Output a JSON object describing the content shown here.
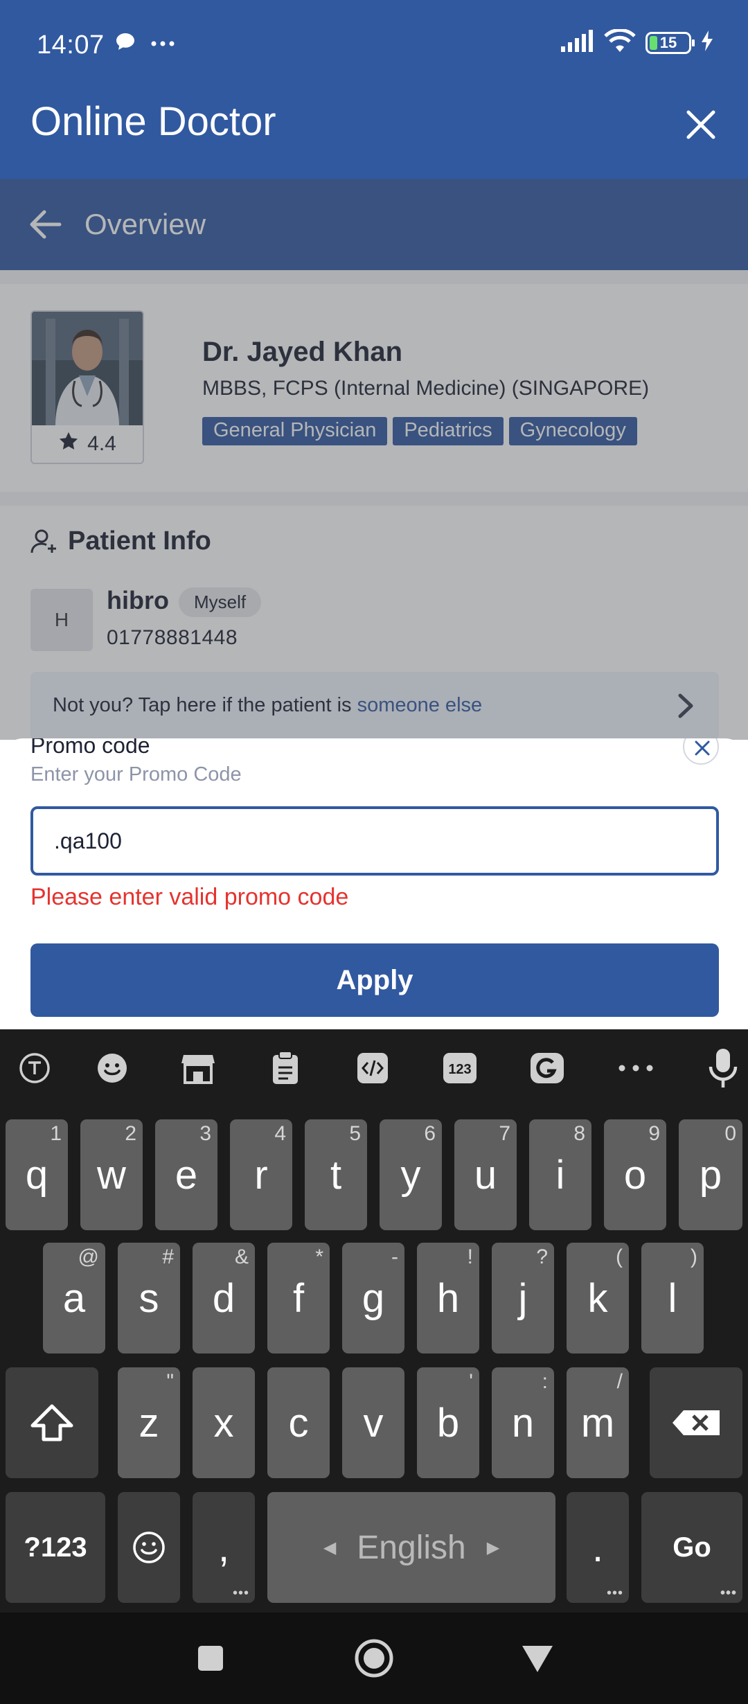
{
  "status_bar": {
    "time": "14:07",
    "battery_level": "15",
    "icons": [
      "chat-bubble-icon",
      "more-dots-icon",
      "signal-icon",
      "wifi-icon",
      "battery-icon",
      "charging-icon"
    ]
  },
  "app_bar": {
    "title": "Online Doctor",
    "close_icon": "close-icon"
  },
  "subheader": {
    "title": "Overview",
    "back_icon": "arrow-left-icon"
  },
  "doctor": {
    "name": "Dr. Jayed Khan",
    "degree": "MBBS, FCPS (Internal Medicine) (SINGAPORE)",
    "rating": "4.4",
    "tags": [
      "General Physician",
      "Pediatrics",
      "Gynecology"
    ]
  },
  "patient": {
    "heading": "Patient Info",
    "avatar_initial": "H",
    "name": "hibro",
    "relation": "Myself",
    "phone": "01778881448",
    "not_you_text": "Not you? Tap here if the patient is ",
    "not_you_link": "someone else"
  },
  "promo_sheet": {
    "label": "Promo code",
    "hint": "Enter your Promo Code",
    "input_value": ".qa100",
    "error": "Please enter valid promo code",
    "apply_label": "Apply"
  },
  "keyboard": {
    "toolbar_icons": [
      "text-cursor-icon",
      "emoji-icon",
      "store-icon",
      "clipboard-icon",
      "code-icon",
      "numbers-icon",
      "g-icon",
      "more-icon",
      "microphone-icon"
    ],
    "toolbar_123": "123",
    "row1": [
      {
        "key": "q",
        "hint": "1"
      },
      {
        "key": "w",
        "hint": "2"
      },
      {
        "key": "e",
        "hint": "3"
      },
      {
        "key": "r",
        "hint": "4"
      },
      {
        "key": "t",
        "hint": "5"
      },
      {
        "key": "y",
        "hint": "6"
      },
      {
        "key": "u",
        "hint": "7"
      },
      {
        "key": "i",
        "hint": "8"
      },
      {
        "key": "o",
        "hint": "9"
      },
      {
        "key": "p",
        "hint": "0"
      }
    ],
    "row2": [
      {
        "key": "a",
        "hint": "@"
      },
      {
        "key": "s",
        "hint": "#"
      },
      {
        "key": "d",
        "hint": "&"
      },
      {
        "key": "f",
        "hint": "*"
      },
      {
        "key": "g",
        "hint": "-"
      },
      {
        "key": "h",
        "hint": "!"
      },
      {
        "key": "j",
        "hint": "?"
      },
      {
        "key": "k",
        "hint": "("
      },
      {
        "key": "l",
        "hint": ")"
      }
    ],
    "row3": [
      {
        "key": "z",
        "hint": "\""
      },
      {
        "key": "x",
        "hint": ""
      },
      {
        "key": "c",
        "hint": ""
      },
      {
        "key": "v",
        "hint": ""
      },
      {
        "key": "b",
        "hint": "'"
      },
      {
        "key": "n",
        "hint": ":"
      },
      {
        "key": "m",
        "hint": "/"
      }
    ],
    "symbols_label": "?123",
    "comma": ",",
    "space_label": "English",
    "period": ".",
    "action_label": "Go"
  },
  "colors": {
    "brand": "#3159a0",
    "error": "#e5332f",
    "keyboard_bg": "#1c1c1c",
    "key_bg": "#5f5f5f"
  }
}
